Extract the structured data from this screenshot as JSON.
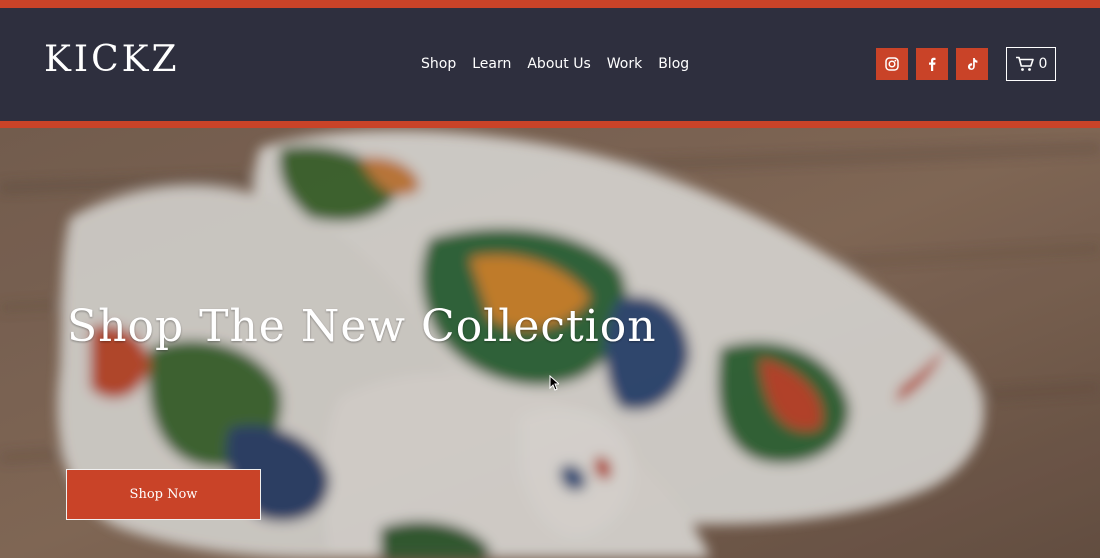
{
  "brand": {
    "logo_text": "KICKZ"
  },
  "nav": {
    "items": [
      {
        "label": "Shop"
      },
      {
        "label": "Learn"
      },
      {
        "label": "About Us"
      },
      {
        "label": "Work"
      },
      {
        "label": "Blog"
      }
    ]
  },
  "social": {
    "icons": [
      "instagram-icon",
      "facebook-icon",
      "tiktok-icon"
    ]
  },
  "cart": {
    "icon": "cart-icon",
    "count": "0"
  },
  "hero": {
    "title": "Shop The New Collection",
    "cta_label": "Shop Now"
  },
  "colors": {
    "accent": "#c94328",
    "header_bg": "#2e2f3e",
    "text": "#ffffff"
  }
}
